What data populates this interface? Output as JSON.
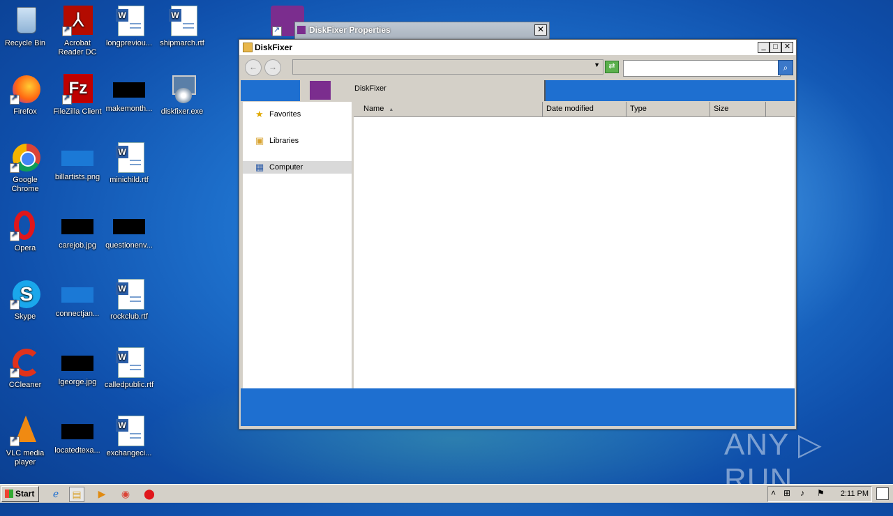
{
  "desktop": {
    "icons": [
      {
        "label": "Recycle Bin"
      },
      {
        "label": "Acrobat Reader DC"
      },
      {
        "label": "longpreviou..."
      },
      {
        "label": "shipmarch.rtf"
      },
      {
        "label": "Firefox"
      },
      {
        "label": "FileZilla Client"
      },
      {
        "label": "makemonth..."
      },
      {
        "label": "diskfixer.exe"
      },
      {
        "label": "Google Chrome"
      },
      {
        "label": "billartists.png"
      },
      {
        "label": "minichild.rtf"
      },
      {
        "label": "Opera"
      },
      {
        "label": "carejob.jpg"
      },
      {
        "label": "questionenv..."
      },
      {
        "label": "Skype"
      },
      {
        "label": "connectjan..."
      },
      {
        "label": "rockclub.rtf"
      },
      {
        "label": "CCleaner"
      },
      {
        "label": "lgeorge.jpg"
      },
      {
        "label": "calledpublic.rtf"
      },
      {
        "label": "VLC media player"
      },
      {
        "label": "locatedtexa..."
      },
      {
        "label": "exchangeci..."
      }
    ]
  },
  "properties_dialog": {
    "title": "DiskFixer Properties",
    "close": "✕"
  },
  "explorer": {
    "title": "DiskFixer",
    "window_buttons": {
      "minimize": "_",
      "maximize": "□",
      "close": "✕"
    },
    "address": {
      "value": "",
      "dropdown": "▼"
    },
    "search": {
      "placeholder": ""
    },
    "folder_header_label": "DiskFixer",
    "nav": {
      "favorites": "Favorites",
      "libraries": "Libraries",
      "computer": "Computer"
    },
    "columns": {
      "name": "Name",
      "date": "Date modified",
      "type": "Type",
      "size": "Size"
    }
  },
  "taskbar": {
    "start": "Start",
    "time": "2:11 PM"
  },
  "watermark": "ANY ▷ RUN"
}
